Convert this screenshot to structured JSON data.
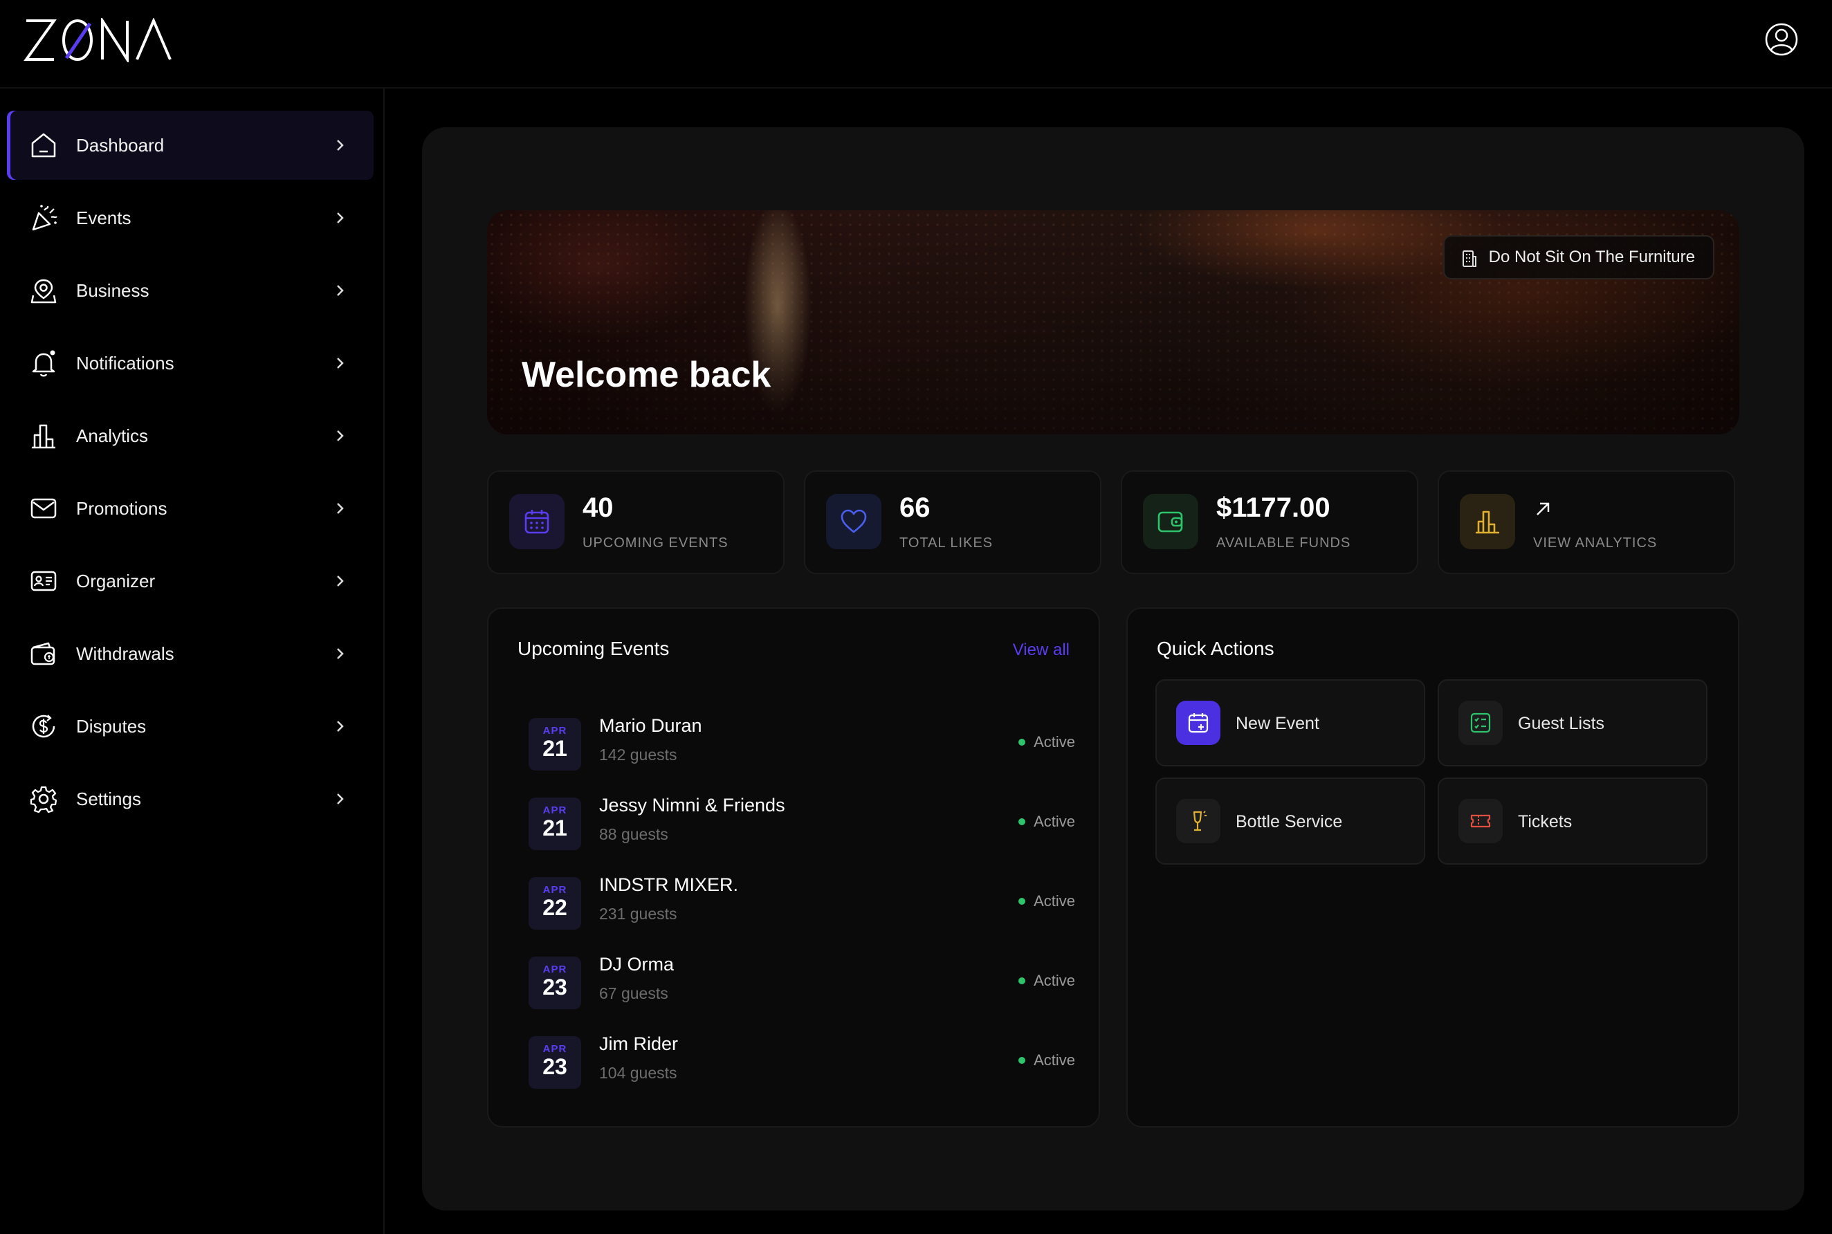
{
  "brand": {
    "logo_text": "ZONA"
  },
  "sidebar": {
    "items": [
      {
        "label": "Dashboard",
        "icon": "home-icon",
        "active": true
      },
      {
        "label": "Events",
        "icon": "party-popper-icon"
      },
      {
        "label": "Business",
        "icon": "map-pin-icon"
      },
      {
        "label": "Notifications",
        "icon": "bell-icon"
      },
      {
        "label": "Analytics",
        "icon": "bar-chart-icon"
      },
      {
        "label": "Promotions",
        "icon": "mail-icon"
      },
      {
        "label": "Organizer",
        "icon": "id-card-icon"
      },
      {
        "label": "Withdrawals",
        "icon": "wallet-icon"
      },
      {
        "label": "Disputes",
        "icon": "dollar-circle-icon"
      },
      {
        "label": "Settings",
        "icon": "gear-icon"
      }
    ]
  },
  "hero": {
    "title": "Welcome back",
    "venue_name": "Do Not Sit On The Furniture"
  },
  "stats": [
    {
      "value": "40",
      "label": "UPCOMING EVENTS",
      "icon": "calendar-icon",
      "accent": "#5a3df0"
    },
    {
      "value": "66",
      "label": "TOTAL LIKES",
      "icon": "heart-icon",
      "accent": "#4a5ef0"
    },
    {
      "value": "$1177.00",
      "label": "AVAILABLE FUNDS",
      "icon": "wallet-icon",
      "accent": "#2ec46b"
    },
    {
      "value": "",
      "label": "VIEW ANALYTICS",
      "icon": "bar-chart-icon",
      "accent": "#e0b030"
    }
  ],
  "upcoming": {
    "title": "Upcoming Events",
    "view_all": "View all",
    "events": [
      {
        "month": "APR",
        "day": "21",
        "name": "Mario Duran",
        "guests": "142 guests",
        "status": "Active"
      },
      {
        "month": "APR",
        "day": "21",
        "name": "Jessy Nimni & Friends",
        "guests": "88 guests",
        "status": "Active"
      },
      {
        "month": "APR",
        "day": "22",
        "name": "INDSTR MIXER.",
        "guests": "231 guests",
        "status": "Active"
      },
      {
        "month": "APR",
        "day": "23",
        "name": "DJ Orma",
        "guests": "67 guests",
        "status": "Active"
      },
      {
        "month": "APR",
        "day": "23",
        "name": "Jim Rider",
        "guests": "104 guests",
        "status": "Active"
      }
    ]
  },
  "quick_actions": {
    "title": "Quick Actions",
    "items": [
      {
        "label": "New Event",
        "icon": "calendar-plus-icon"
      },
      {
        "label": "Guest Lists",
        "icon": "checklist-icon"
      },
      {
        "label": "Bottle Service",
        "icon": "champagne-glass-icon"
      },
      {
        "label": "Tickets",
        "icon": "ticket-icon"
      }
    ]
  },
  "colors": {
    "accent": "#5a3df0",
    "status_active": "#2ec46b",
    "background": "#000000",
    "panel": "#111111"
  }
}
